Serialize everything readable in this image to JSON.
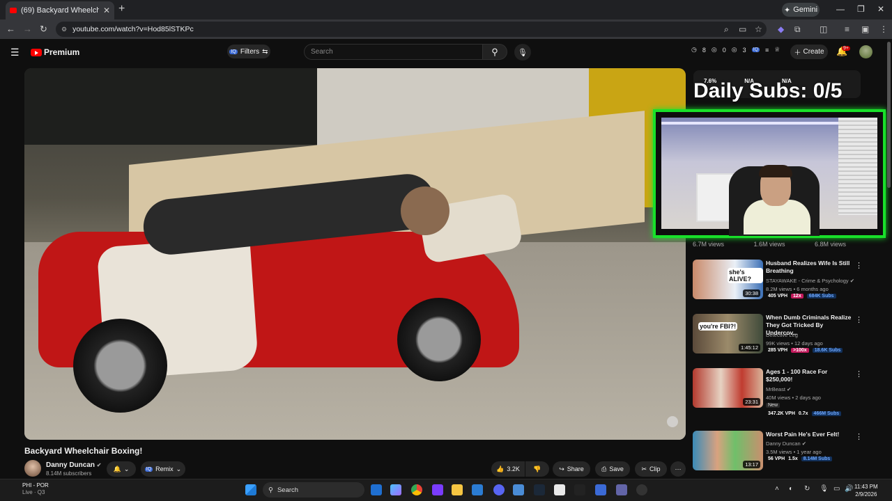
{
  "browser": {
    "tab_title": "(69) Backyard Wheelchair B",
    "url": "youtube.com/watch?v=Hod85lSTKPc",
    "gemini_label": "Gemini"
  },
  "header": {
    "brand": "Premium",
    "filters_label": "Filters",
    "search_placeholder": "Search",
    "stats": [
      "8",
      "0",
      "3"
    ],
    "create_label": "Create",
    "notif_count": "9+"
  },
  "overlay": {
    "daily_subs": "Daily Subs: 0/5",
    "stat1": "7.6%",
    "stat2": "N/A",
    "stat3": "N/A",
    "views": [
      "6.7M views",
      "1.6M views",
      "6.8M views"
    ]
  },
  "video": {
    "title": "Backyard Wheelchair Boxing!",
    "channel": "Danny Duncan",
    "subscribers": "8.14M subscribers",
    "remix_label": "Remix",
    "likes": "3.2K",
    "share_label": "Share",
    "save_label": "Save",
    "clip_label": "Clip"
  },
  "recommendations": [
    {
      "title": "Husband Realizes Wife Is Still Breathing",
      "channel": "STAYAWAKE - Crime & Psychology",
      "meta": "8.2M views • 6 months ago",
      "duration": "30:38",
      "vph": "405 VPH",
      "mult": "12x",
      "subs": "684K Subs",
      "thumb_text": "she's ALIVE?"
    },
    {
      "title": "When Dumb Criminals Realize They Got Tricked By Undercov...",
      "channel": "Detective Leg",
      "meta": "99K views • 12 days ago",
      "duration": "1:45:12",
      "vph": "285 VPH",
      "mult": ">100x",
      "subs": "18.6K Subs",
      "thumb_text": "you're FBI?!"
    },
    {
      "title": "Ages 1 - 100 Race For $250,000!",
      "channel": "MrBeast",
      "meta": "40M views • 2 days ago",
      "duration": "23:31",
      "vph": "347.2K VPH",
      "mult": "0.7x",
      "subs": "466M Subs",
      "new_badge": "New"
    },
    {
      "title": "Worst Pain He's Ever Felt!",
      "channel": "Danny Duncan",
      "meta": "3.5M views • 1 year ago",
      "duration": "13:17",
      "vph": "56 VPH",
      "mult": "1.5x",
      "subs": "8.14M Subs"
    }
  ],
  "taskbar": {
    "weather_line1": "PHI - POR",
    "weather_line2": "Live · Q3",
    "search_label": "Search",
    "time": "11:43 PM",
    "date": "2/9/2026"
  },
  "colors": {
    "accent_red": "#ff0000",
    "webcam_border": "#19e02a"
  }
}
